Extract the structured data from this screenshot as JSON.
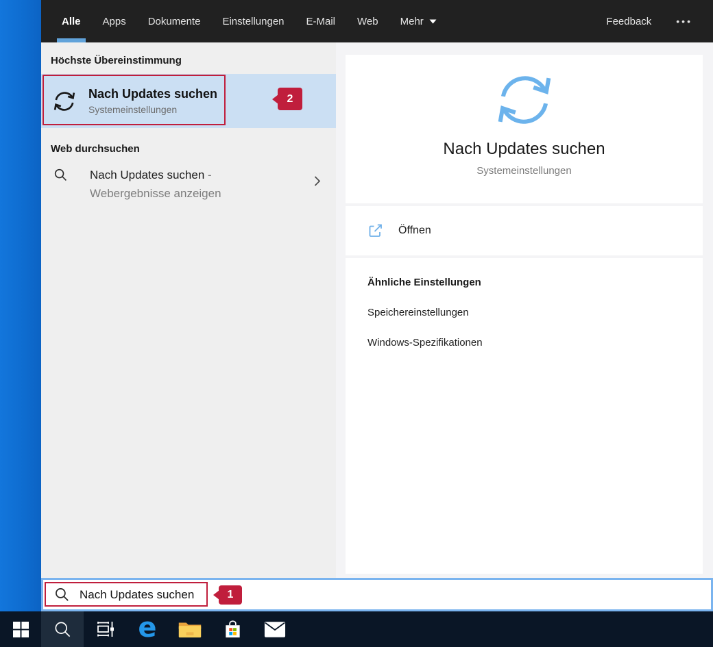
{
  "nav": {
    "tabs": [
      "Alle",
      "Apps",
      "Dokumente",
      "Einstellungen",
      "E-Mail",
      "Web",
      "Mehr"
    ],
    "feedback": "Feedback",
    "overflow": "•••"
  },
  "left_panel": {
    "best_match_header": "Höchste Übereinstimmung",
    "best_match_title": "Nach Updates suchen",
    "best_match_subtitle": "Systemeinstellungen",
    "web_header": "Web durchsuchen",
    "web_query": "Nach Updates suchen",
    "web_suffix": "- Webergebnisse anzeigen"
  },
  "preview": {
    "title": "Nach Updates suchen",
    "subtitle": "Systemeinstellungen",
    "open_label": "Öffnen",
    "related_header": "Ähnliche Einstellungen",
    "related_items": [
      "Speichereinstellungen",
      "Windows-Spezifikationen"
    ]
  },
  "search_bar": {
    "value": "Nach Updates suchen"
  },
  "annotations": {
    "badge1": "1",
    "badge2": "2"
  },
  "taskbar": {
    "icons": [
      "start",
      "search",
      "task-view",
      "edge",
      "file-explorer",
      "store",
      "mail"
    ]
  },
  "colors": {
    "accent_blue": "#0e6ccf",
    "highlight_blue": "#cbdff3",
    "annotation_red": "#c01e3c",
    "focus_border_blue": "#7ab4ef",
    "taskbar_bg": "#0a1626",
    "refresh_blue": "#6cb3ec",
    "nav_bg": "#212121"
  }
}
